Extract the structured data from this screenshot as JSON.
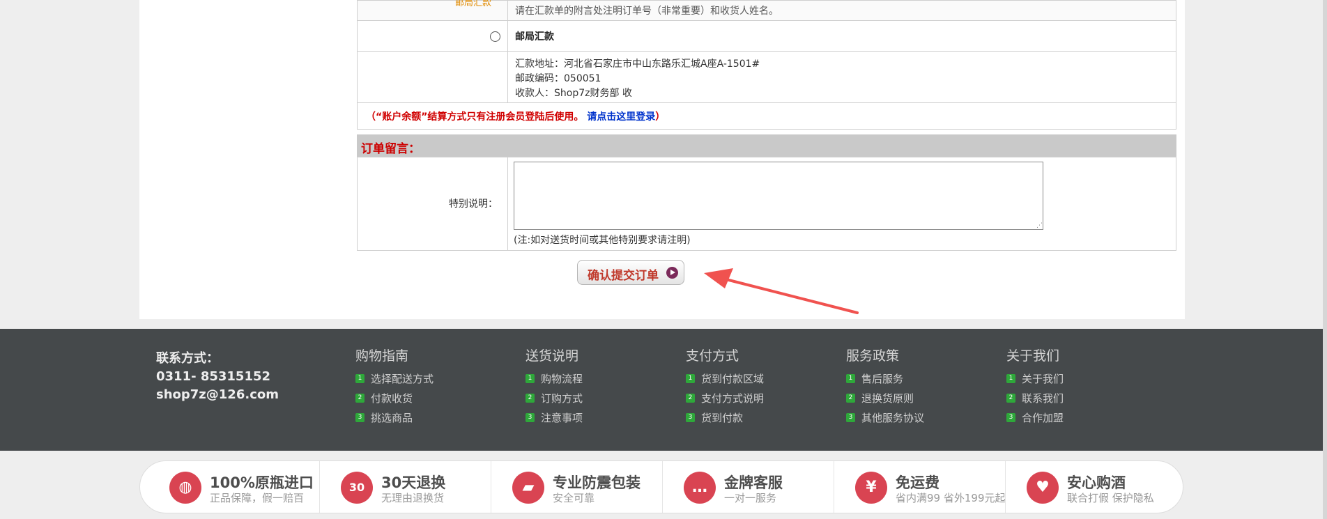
{
  "payment": {
    "cut_label": "邮局汇款",
    "remittance_note": "请在汇款单的附言处注明订单号（非常重要）和收货人姓名。",
    "method_title": "邮局汇款",
    "address_line": "汇款地址：河北省石家庄市中山东路乐汇城A座A-1501#",
    "postcode_line": "邮政编码：050051",
    "payee_line": "收款人：Shop7z财务部 收",
    "balance_warning": "（“账户余额”结算方式只有注册会员登陆后使用。",
    "login_link": "请点击这里登录",
    "close_paren": "）"
  },
  "order_message": {
    "header": "订单留言：",
    "label": "特别说明：",
    "textarea_value": "",
    "hint": "(注:如对送货时间或其他特别要求请注明)"
  },
  "submit_label": "确认提交订单",
  "footer": {
    "contact_title": "联系方式：",
    "phone": "0311- 85315152",
    "email": "shop7z@126.com",
    "columns": [
      {
        "title": "购物指南",
        "items": [
          "选择配送方式",
          "付款收货",
          "挑选商品"
        ]
      },
      {
        "title": "送货说明",
        "items": [
          "购物流程",
          "订购方式",
          "注意事项"
        ]
      },
      {
        "title": "支付方式",
        "items": [
          "货到付款区域",
          "支付方式说明",
          "货到付款"
        ]
      },
      {
        "title": "服务政策",
        "items": [
          "售后服务",
          "退换货原则",
          "其他服务协议"
        ]
      },
      {
        "title": "关于我们",
        "items": [
          "关于我们",
          "联系我们",
          "合作加盟"
        ]
      }
    ]
  },
  "features": [
    {
      "title": "100%原瓶进口",
      "sub": "正品保障，假一赔百",
      "icon": "globe-icon",
      "glyph": "◍"
    },
    {
      "title": "30天退换",
      "sub": "无理由退换货",
      "icon": "calendar-icon",
      "glyph": "30"
    },
    {
      "title": "专业防震包装",
      "sub": "安全可靠",
      "icon": "truck-icon",
      "glyph": "▰"
    },
    {
      "title": "金牌客服",
      "sub": "一对一服务",
      "icon": "chat-icon",
      "glyph": "…"
    },
    {
      "title": "免运费",
      "sub": "省内满99 省外199元起",
      "icon": "yen-icon",
      "glyph": "¥"
    },
    {
      "title": "安心购酒",
      "sub": "联合打假 保护隐私",
      "icon": "heart-icon",
      "glyph": "♥"
    }
  ],
  "numbers": [
    "1",
    "2",
    "3"
  ],
  "colors": {
    "accent_red": "#cc0000",
    "link_blue": "#0033cc",
    "footer_bg": "#45494b",
    "feature_red": "#d94452"
  }
}
